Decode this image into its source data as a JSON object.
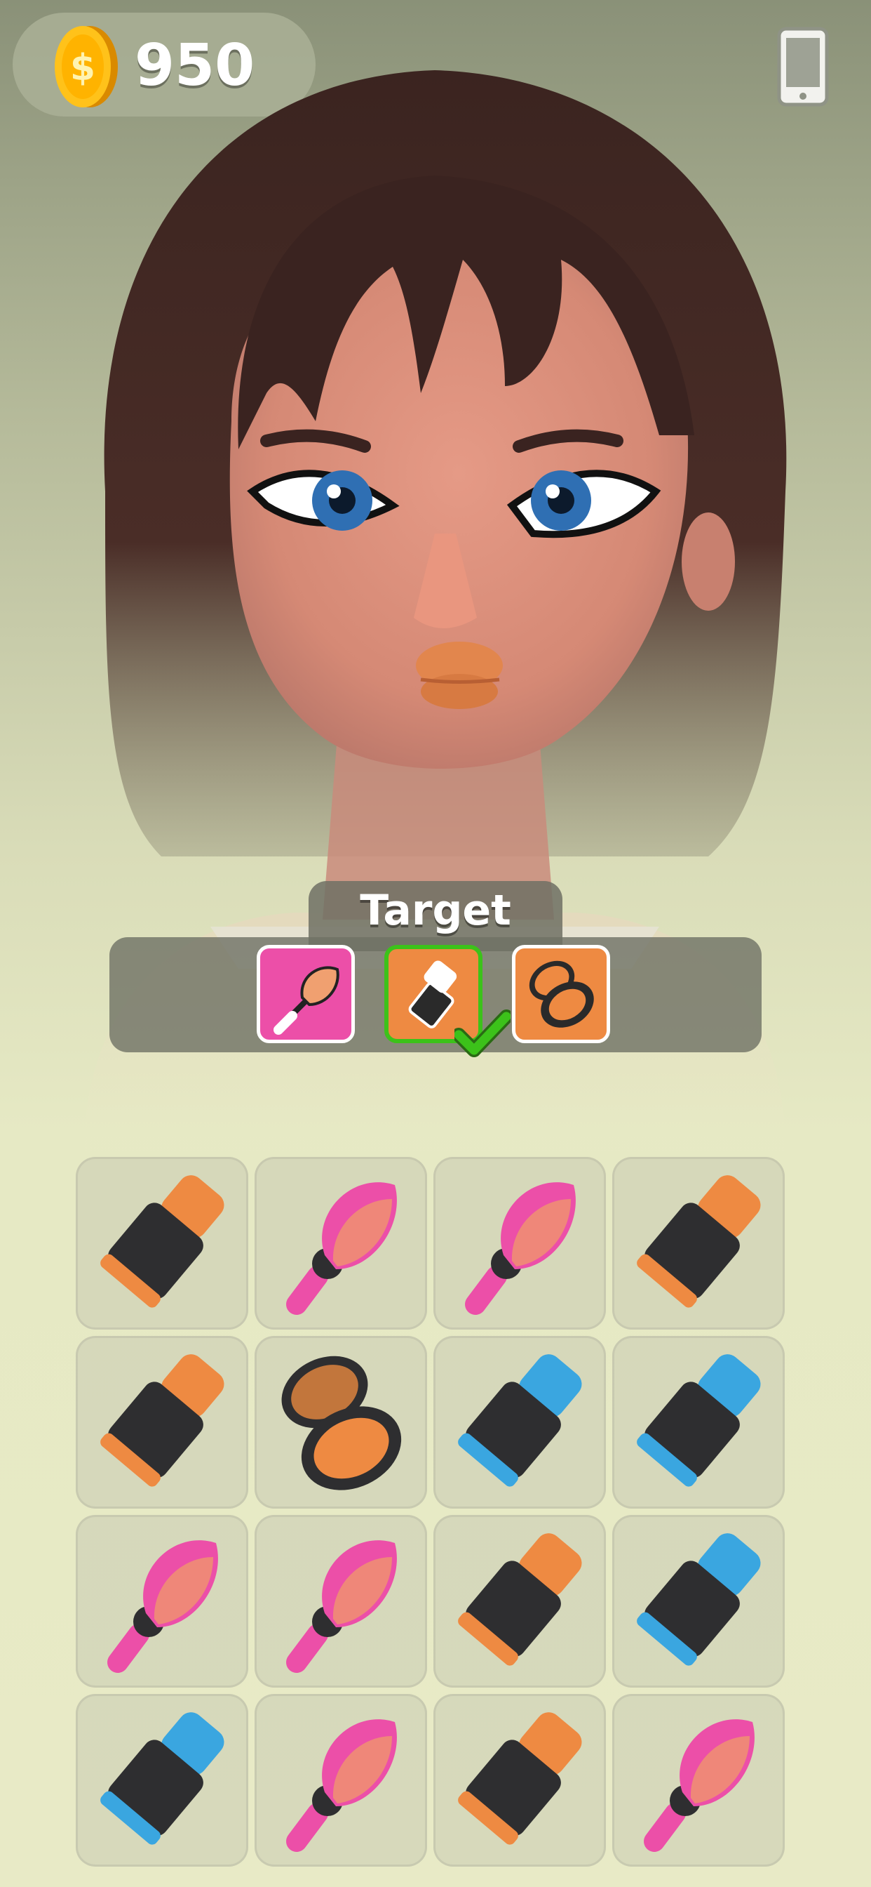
{
  "hud": {
    "coins": "950",
    "coin_icon": "gold-coin-icon",
    "device_icon": "phone-icon"
  },
  "target": {
    "label": "Target",
    "items": [
      {
        "type": "blush-brush",
        "bg": "#ec4fa8",
        "done": false
      },
      {
        "type": "lipstick-orange",
        "bg": "#ee8a42",
        "done": true
      },
      {
        "type": "compact-powder",
        "bg": "#ee8a42",
        "done": false
      }
    ]
  },
  "grid": {
    "rows": [
      [
        "lipstick-orange",
        "blush-brush",
        "blush-brush",
        "lipstick-orange"
      ],
      [
        "lipstick-orange",
        "compact-powder",
        "lipstick-blue",
        "lipstick-blue"
      ],
      [
        "blush-brush",
        "blush-brush",
        "lipstick-orange",
        "lipstick-blue"
      ],
      [
        "lipstick-blue",
        "blush-brush",
        "lipstick-orange",
        "blush-brush"
      ]
    ]
  },
  "colors": {
    "orange": "#ee8a42",
    "blue": "#3aa6e0",
    "pink": "#ec4fa8",
    "check_green": "#3cc21a"
  }
}
